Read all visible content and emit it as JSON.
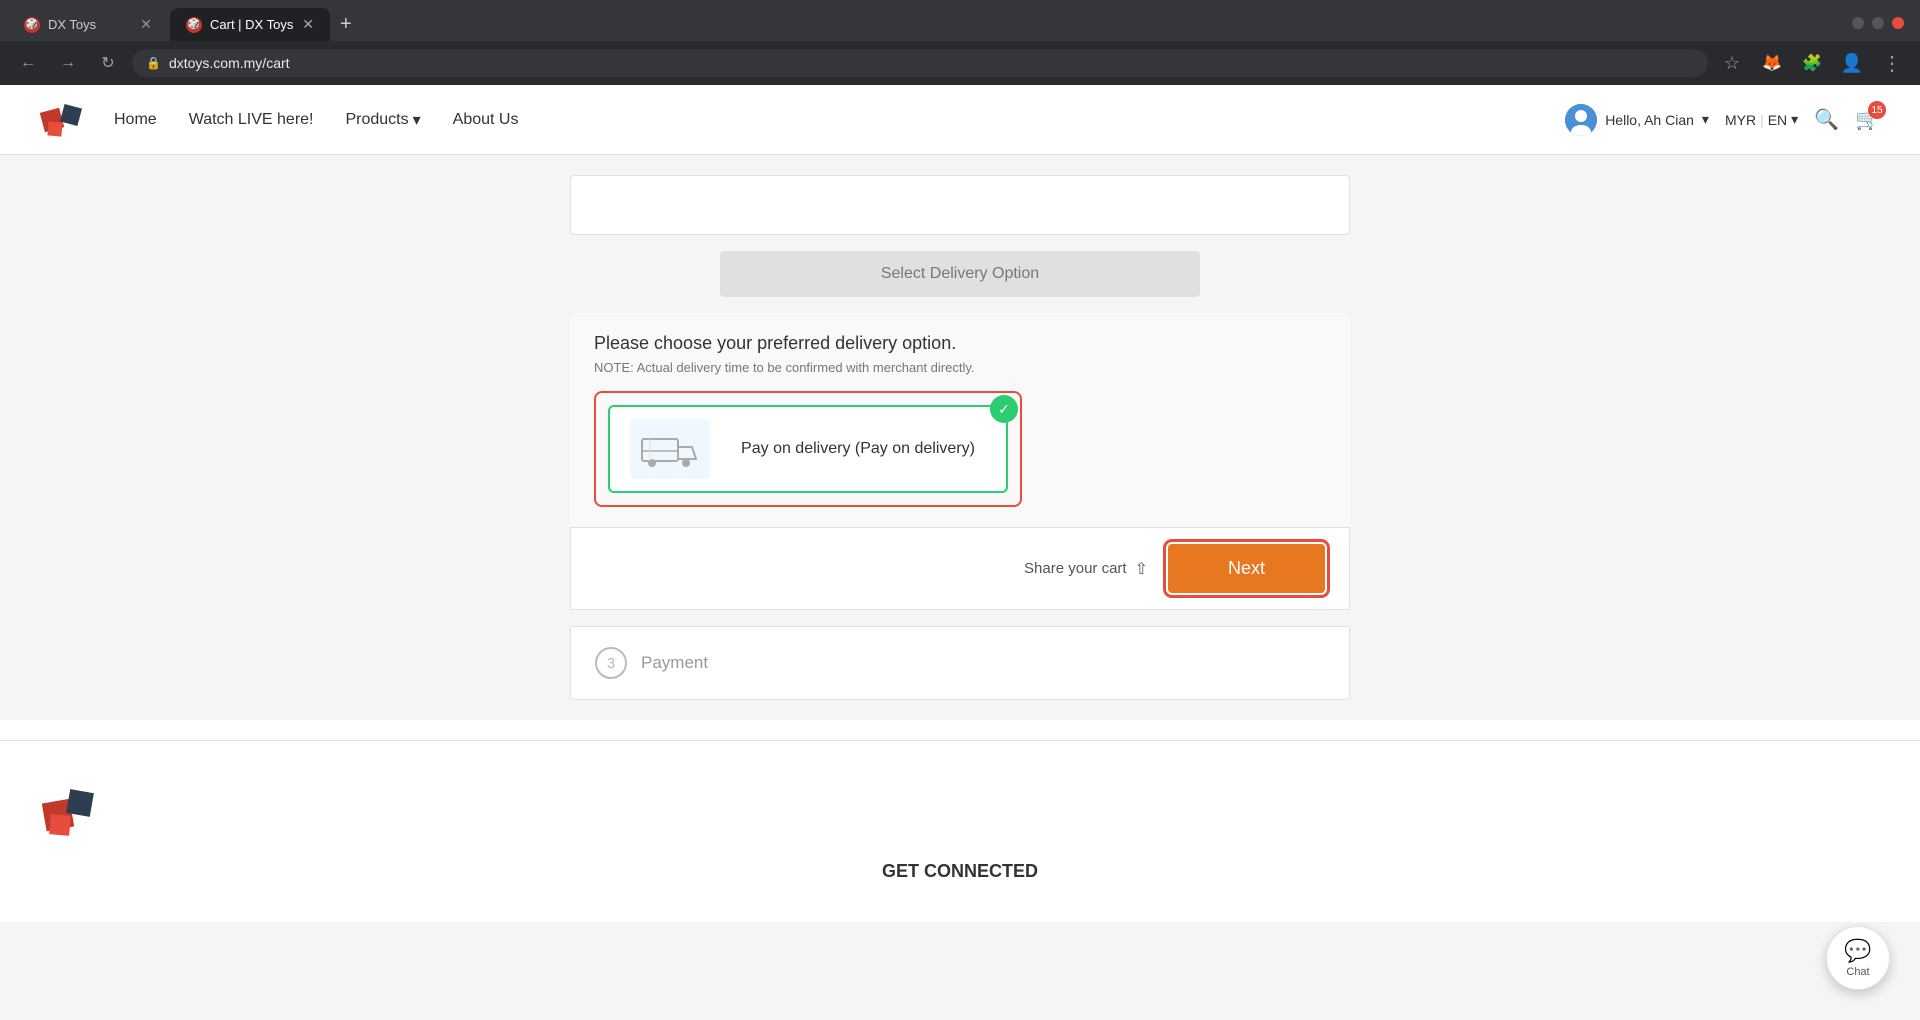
{
  "browser": {
    "tabs": [
      {
        "id": "tab1",
        "favicon": "🎲",
        "label": "DX Toys",
        "active": false,
        "url": ""
      },
      {
        "id": "tab2",
        "favicon": "🎲",
        "label": "Cart | DX Toys",
        "active": true,
        "url": "dxtoys.com.my/cart"
      }
    ],
    "new_tab_label": "+",
    "back_icon": "←",
    "forward_icon": "→",
    "refresh_icon": "↻",
    "home_icon": "⌂",
    "address": "dxtoys.com.my/cart",
    "bookmark_icon": "☆",
    "profile_icon": "👤"
  },
  "header": {
    "logo_alt": "DX Toys Logo",
    "nav": {
      "home": "Home",
      "watch_live": "Watch LIVE here!",
      "products": "Products",
      "about_us": "About Us"
    },
    "user": {
      "greeting": "Hello, Ah Cian",
      "avatar_url": ""
    },
    "currency": "MYR",
    "language": "EN",
    "cart_count": "15"
  },
  "delivery_section": {
    "select_btn_label": "Select Delivery Option",
    "title": "Please choose your preferred delivery option.",
    "note": "NOTE: Actual delivery time to be confirmed with merchant directly.",
    "option": {
      "label": "Pay on delivery (Pay on delivery)",
      "icon_alt": "delivery truck"
    }
  },
  "action_bar": {
    "share_label": "Share your cart",
    "share_icon": "⬆",
    "next_label": "Next"
  },
  "payment_step": {
    "step_number": "3",
    "label": "Payment"
  },
  "footer": {
    "title": "GET CONNECTED"
  },
  "chat": {
    "label": "Chat",
    "icon": "💬"
  }
}
